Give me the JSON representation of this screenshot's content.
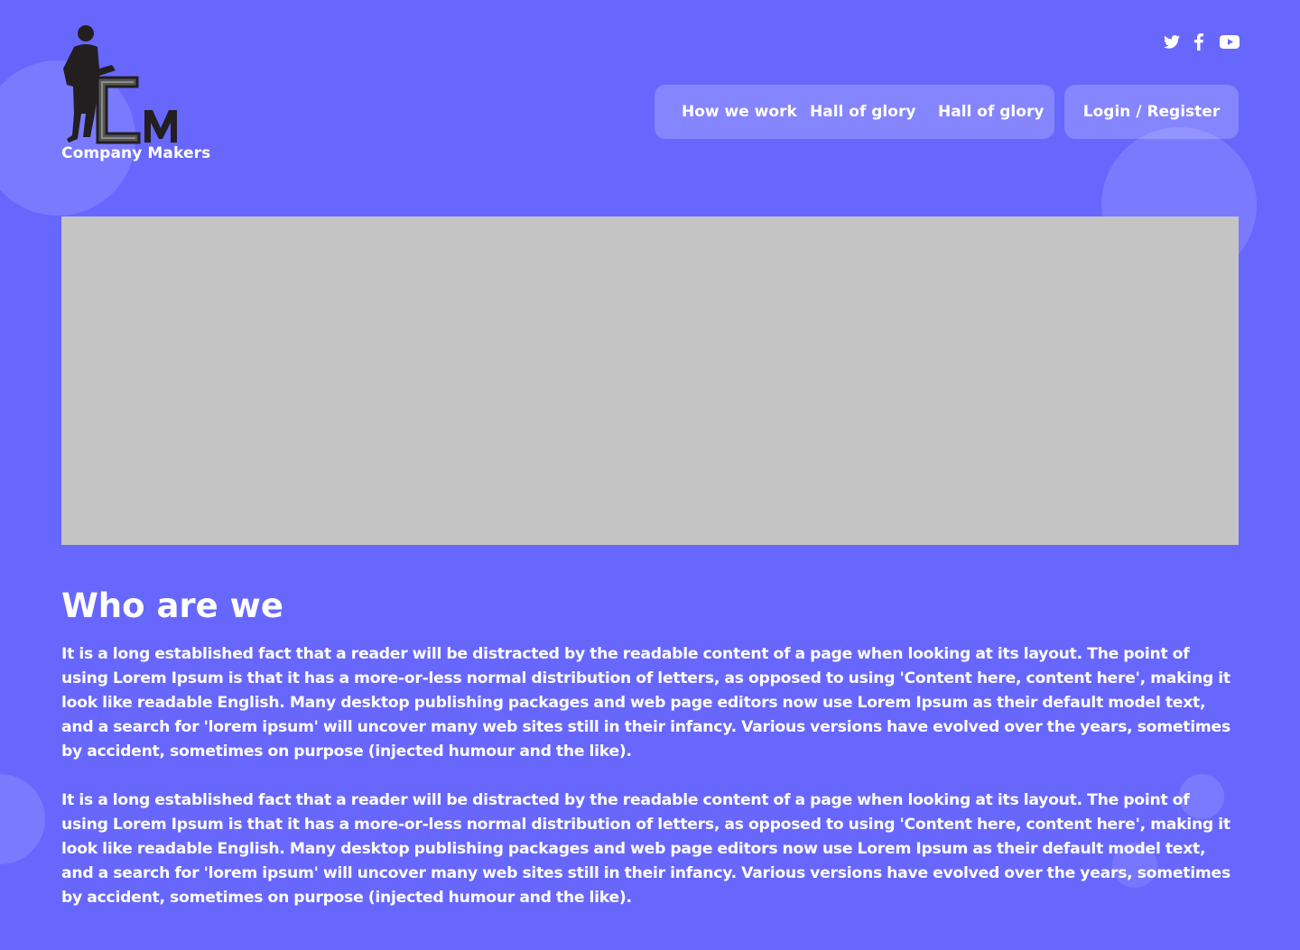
{
  "brand": {
    "logo_text": "Company Makers",
    "logo_icon": "cm-person-icon"
  },
  "social": {
    "twitter_icon": "twitter-icon",
    "facebook_icon": "facebook-icon",
    "youtube_icon": "youtube-icon"
  },
  "nav": {
    "items": [
      {
        "label": "How we work"
      },
      {
        "label": "Hall of glory"
      },
      {
        "label": "Hall of glory"
      }
    ],
    "login_label": "Login / Register"
  },
  "main": {
    "heading": "Who are we",
    "paragraphs": [
      "It is a long established fact that a reader will be distracted by the readable content of a page when looking at its layout. The point of using Lorem Ipsum is that it has a more-or-less normal distribution of letters, as opposed to using 'Content here, content here', making it look like readable English. Many desktop publishing packages and web page editors now use Lorem Ipsum as their default model text, and a search for 'lorem ipsum' will uncover many web sites still in their infancy. Various versions have evolved over the years, sometimes by accident, sometimes on purpose (injected humour and the like).",
      "It is a long established fact that a reader will be distracted by the readable content of a page when looking at its layout. The point of using Lorem Ipsum is that it has a more-or-less normal distribution of letters, as opposed to using 'Content here, content here', making it look like readable English. Many desktop publishing packages and web page editors now use Lorem Ipsum as their default model text, and a search for 'lorem ipsum' will uncover many web sites still in their infancy. Various versions have evolved over the years, sometimes by accident, sometimes on purpose (injected humour and the like)."
    ]
  },
  "colors": {
    "background": "#6767fe",
    "hero_placeholder": "#c4c4c4",
    "text": "#ffffff"
  }
}
